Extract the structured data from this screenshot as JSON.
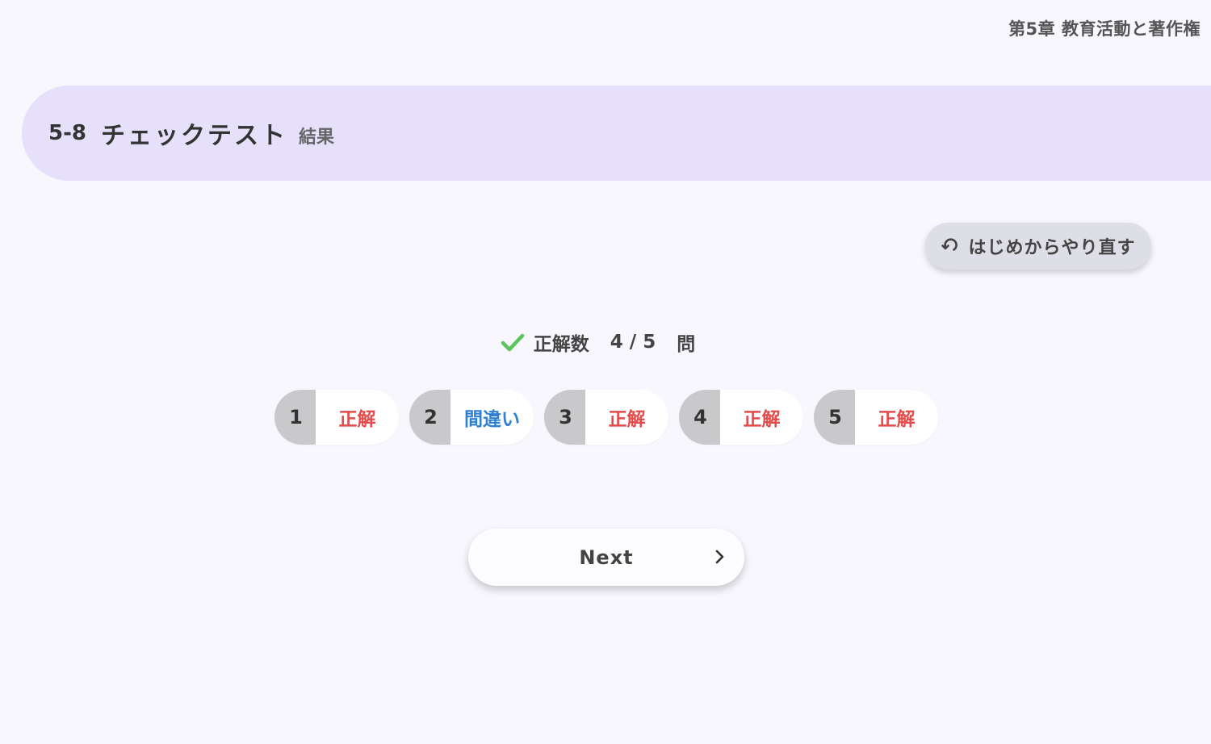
{
  "header": {
    "chapter_label": "第5章 教育活動と著作権"
  },
  "title_band": {
    "section_number": "5-8",
    "section_title": "チェックテスト",
    "section_subtitle": "結果"
  },
  "restart_button": {
    "icon": "restart-arrow-icon",
    "label": "はじめからやり直す"
  },
  "score": {
    "icon": "check-icon",
    "label": "正解数",
    "value": "4 / 5",
    "unit": "問",
    "correct_count": 4,
    "total": 5
  },
  "results": [
    {
      "number": "1",
      "verdict": "正解",
      "status": "correct"
    },
    {
      "number": "2",
      "verdict": "間違い",
      "status": "wrong"
    },
    {
      "number": "3",
      "verdict": "正解",
      "status": "correct"
    },
    {
      "number": "4",
      "verdict": "正解",
      "status": "correct"
    },
    {
      "number": "5",
      "verdict": "正解",
      "status": "correct"
    }
  ],
  "next_button": {
    "label": "Next",
    "icon": "chevron-right-icon"
  },
  "colors": {
    "background": "#f7f7fd",
    "title_band": "#e6e0fb",
    "correct": "#e64a4a",
    "wrong": "#2f7fd3",
    "check": "#5cc45c"
  }
}
